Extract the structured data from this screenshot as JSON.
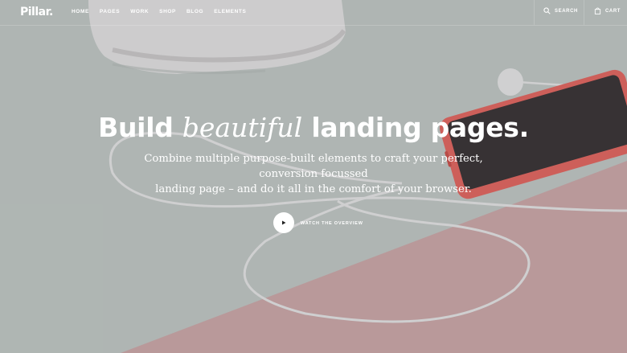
{
  "brand": {
    "logo": "Pillar."
  },
  "nav": {
    "items": [
      {
        "label": "HOME"
      },
      {
        "label": "PAGES"
      },
      {
        "label": "WORK"
      },
      {
        "label": "SHOP"
      },
      {
        "label": "BLOG"
      },
      {
        "label": "ELEMENTS"
      }
    ],
    "search_label": "SEARCH",
    "cart_label": "CART"
  },
  "hero": {
    "headline_before": "Build",
    "headline_emphasis": "beautiful",
    "headline_after": "landing pages.",
    "subtext_line1": "Combine multiple purpose-built elements to craft your perfect, conversion focussed",
    "subtext_line2": "landing page – and do it all in the comfort of your browser.",
    "cta_label": "WATCH THE OVERVIEW"
  },
  "colors": {
    "background_mint": "#c7cfcb",
    "paper_pink": "#d9b0b0",
    "phone_coral": "#f06b64",
    "text": "#ffffff"
  }
}
